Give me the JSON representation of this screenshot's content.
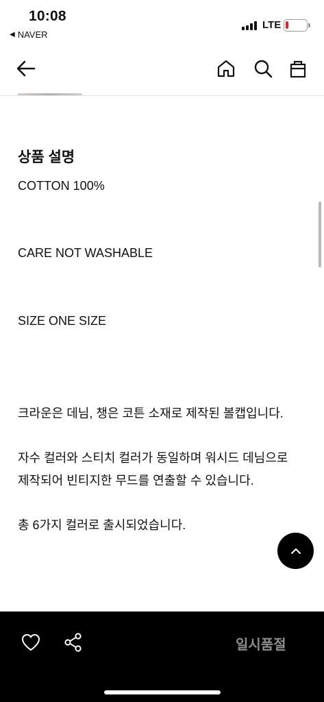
{
  "status_bar": {
    "time": "10:08",
    "back_app": "NAVER",
    "network": "LTE",
    "battery_level": 0.1
  },
  "nav": {
    "icons": [
      "back-arrow-icon",
      "home-icon",
      "search-icon",
      "shopping-bag-icon"
    ]
  },
  "product": {
    "section_title": "상품 설명",
    "specs": [
      "COTTON 100%",
      "CARE NOT WASHABLE",
      "SIZE ONE SIZE"
    ],
    "description": [
      "크라운은 데님, 챙은 코튼 소재로 제작된 볼캡입니다.",
      "자수 컬러와 스티치 컬러가 동일하며 워시드 데님으로",
      "제작되어 빈티지한 무드를 연출할 수 있습니다.",
      "총 6가지 컬러로 출시되었습니다."
    ]
  },
  "bottom_bar": {
    "soldout_label": "일시품절",
    "icons": [
      "heart-icon",
      "share-icon"
    ]
  },
  "colors": {
    "bottom_bar_bg": "#000000",
    "soldout_text": "#8e8e8e",
    "battery_low": "#e0242a"
  }
}
